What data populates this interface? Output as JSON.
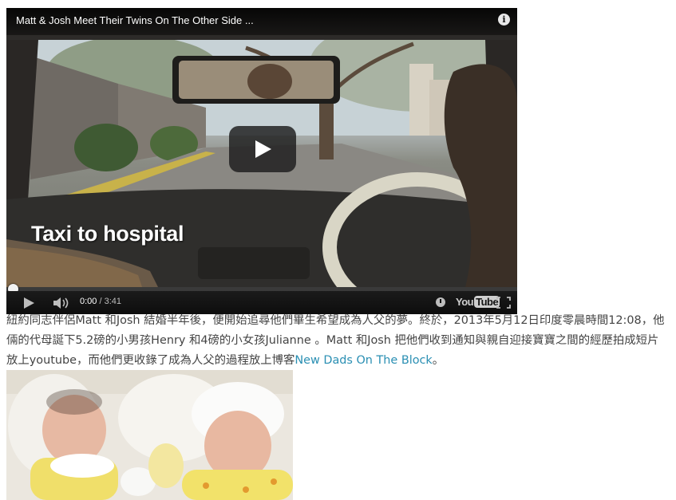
{
  "video": {
    "title": "Matt & Josh Meet Their Twins On The Other Side ...",
    "caption": "Taxi to hospital",
    "time_current": "0:00",
    "time_separator": " / ",
    "time_total": "3:41",
    "progress_fraction": 0.0,
    "logo_you": "You",
    "logo_tube": "Tube",
    "icons": [
      "info-icon",
      "play-icon",
      "volume-icon",
      "watch-later-icon",
      "youtube-logo",
      "fullscreen-icon"
    ]
  },
  "article": {
    "text_before_link": "紐約同志伴侶Matt 和Josh 結婚半年後，便開始追尋他們畢生希望成為人父的夢。終於，2013年5月12日印度零晨時間12:08，他倆的代母誕下5.2磅的小男孩Henry 和4磅的小女孩Julianne 。Matt 和Josh 把他們收到通知與親自迎接寶寶之間的經歷拍成短片放上youtube，而他們更收錄了成為人父的過程放上博客",
    "link_text": "New Dads On The Block",
    "text_after_link": "。"
  },
  "colors": {
    "link": "#2a8fb3",
    "text": "#444444",
    "progress": "#cc181e"
  }
}
